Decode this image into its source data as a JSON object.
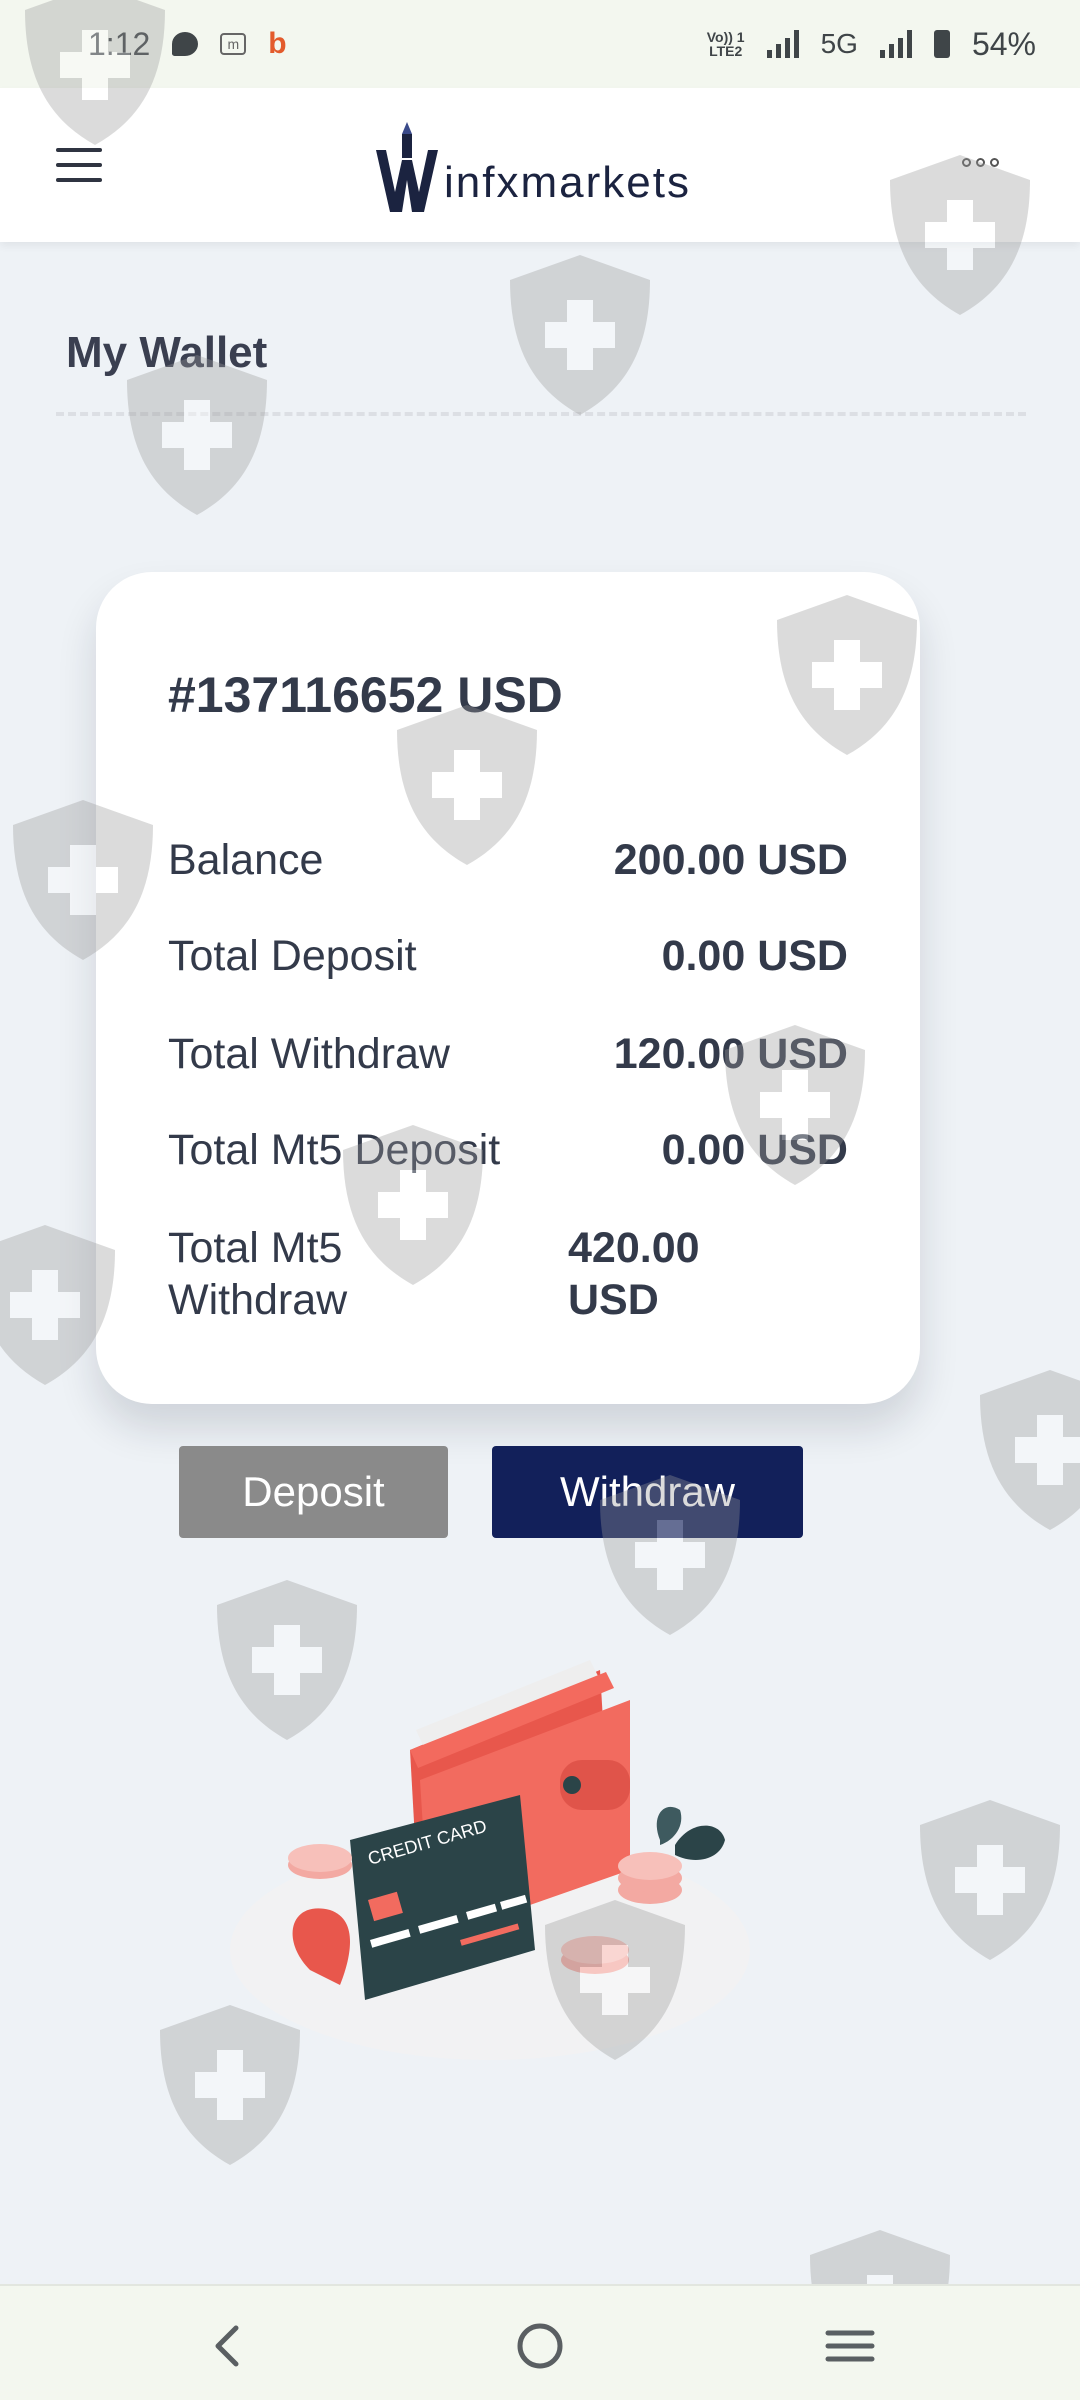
{
  "status_bar": {
    "time": "1:12",
    "network_label": "5G",
    "volte_label": "Vo)) 1\nLTE2",
    "battery_percent": "54%",
    "notification_icons": [
      "chat-bubble-icon",
      "m-box-icon",
      "b-app-icon"
    ]
  },
  "header": {
    "logo_text": "infxmarkets",
    "menu_icon": "hamburger-icon",
    "more_icon": "more-dots-icon"
  },
  "page": {
    "title": "My Wallet"
  },
  "wallet": {
    "account_id": "#137116652 USD",
    "rows": [
      {
        "label": "Balance",
        "value": "200.00 USD"
      },
      {
        "label": "Total Deposit",
        "value": "0.00 USD"
      },
      {
        "label": "Total Withdraw",
        "value": "120.00 USD"
      },
      {
        "label": "Total Mt5 Deposit",
        "value": "0.00 USD"
      },
      {
        "label": "Total Mt5 Withdraw",
        "value": "420.00 USD"
      }
    ]
  },
  "actions": {
    "deposit_label": "Deposit",
    "withdraw_label": "Withdraw"
  },
  "illustration": {
    "card_text": "CREDIT CARD",
    "icon": "wallet-credit-card-illustration"
  },
  "nav": {
    "back_icon": "back-chevron-icon",
    "home_icon": "home-circle-icon",
    "recents_icon": "recents-lines-icon"
  },
  "colors": {
    "background": "#eef2f6",
    "deposit_button": "#8a8a8a",
    "withdraw_button": "#12205a",
    "wallet_red": "#f0645a",
    "card_dark": "#2b4448",
    "brand_navy": "#1b2340"
  }
}
